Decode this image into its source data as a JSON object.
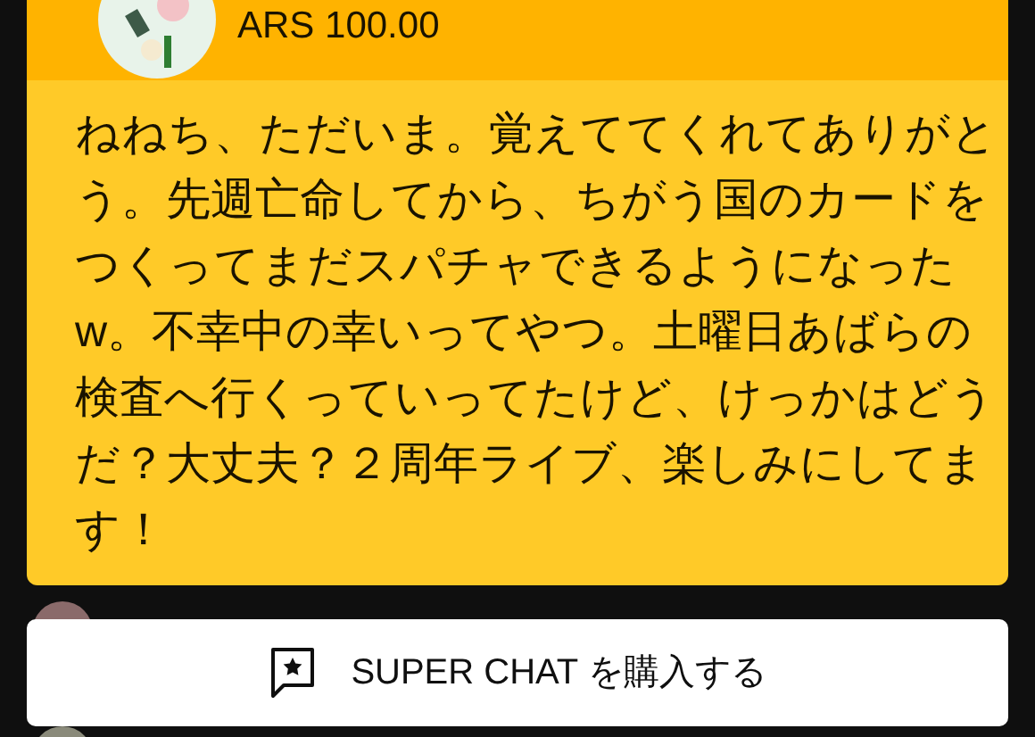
{
  "superchat": {
    "amount": "ARS 100.00",
    "message": "ねねち、ただいま。覚えててくれてありがとう。先週亡命してから、ちがう国のカードをつくってまだスパチャできるようになったw。不幸中の幸いってやつ。土曜日あばらの検査へ行くっていってたけど、けっかはどうだ？大丈夫？２周年ライブ、楽しみにしてます！"
  },
  "buy_button": {
    "label": "SUPER CHAT を購入する"
  }
}
